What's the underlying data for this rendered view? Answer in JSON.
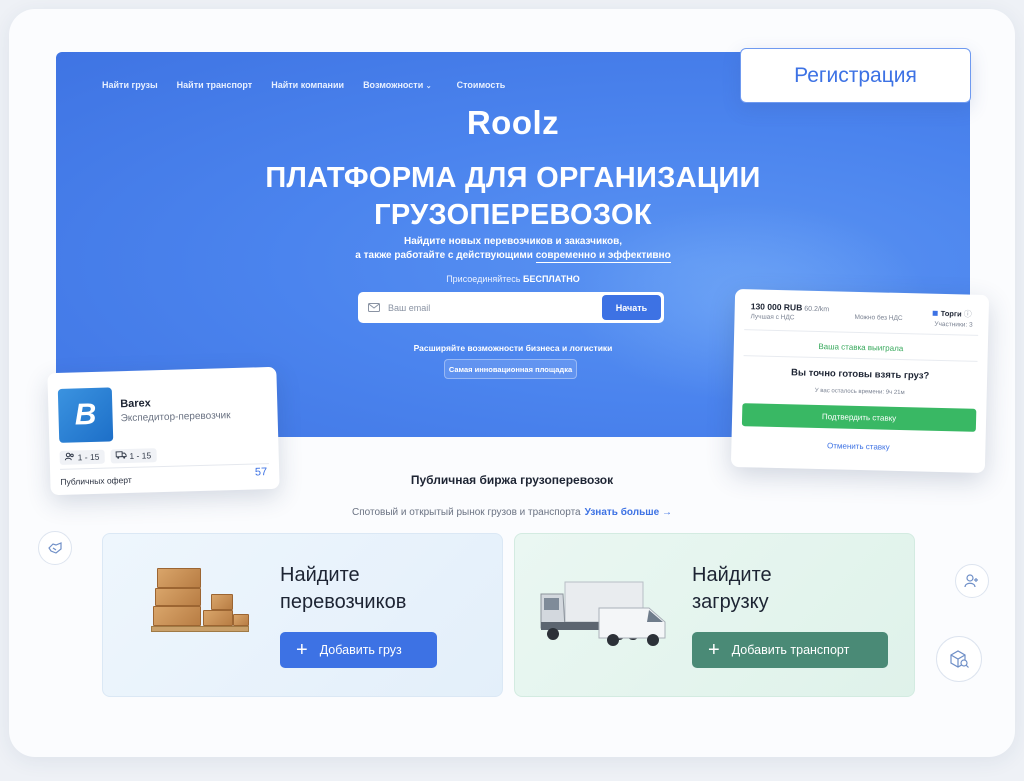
{
  "nav": {
    "items": [
      "Найти грузы",
      "Найти транспорт",
      "Найти компании",
      "Возможности",
      "Стоимость"
    ]
  },
  "register_label": "Регистрация",
  "hero": {
    "logo": "Roolz",
    "headline_line1": "ПЛАТФОРМА ДЛЯ ОРГАНИЗАЦИИ",
    "headline_line2": "ГРУЗОПЕРЕВОЗОК",
    "sub_line1": "Найдите новых перевозчиков и заказчиков,",
    "sub_line2_prefix": "а также работайте с действующими ",
    "sub_line2_emph": "современно и эффективно",
    "join_prefix": "Присоединяйтесь ",
    "join_bold": "БЕСПЛАТНО",
    "email_placeholder": "Ваш email",
    "start_label": "Начать",
    "expand_text": "Расширяйте возможности бизнеса и логистики",
    "pill_text": "Самая инновационная площадка"
  },
  "company_card": {
    "logo_letter": "B",
    "name": "Barex",
    "role": "Экспедитор-перевозчик",
    "tag1": "1 - 15",
    "tag2": "1 - 15",
    "offers_label": "Публичных оферт",
    "offers_count": "57"
  },
  "bid_card": {
    "price": "130 000 RUB",
    "rate": "60.2/km",
    "best": "Лучшая с НДС",
    "nds": "Можно без НДС",
    "torgi": "Торги",
    "participants": "Участники: 3",
    "won": "Ваша ставка выиграла",
    "question": "Вы точно готовы взять груз?",
    "time_left": "У вас осталось времени: 9ч 21м",
    "confirm": "Подтвердить ставку",
    "cancel": "Отменить ставку"
  },
  "exchange": {
    "title": "Публичная биржа грузоперевозок",
    "subtitle": "Спотовый и открытый рынок грузов и транспорта",
    "more": "Узнать больше →"
  },
  "cards": {
    "carriers_line1": "Найдите",
    "carriers_line2": "перевозчиков",
    "add_cargo": "Добавить груз",
    "cargo_line1": "Найдите",
    "cargo_line2": "загрузку",
    "add_transport": "Добавить транспорт"
  },
  "colors": {
    "accent": "#3d72e4",
    "green": "#39b864",
    "teal": "#4a8a76"
  }
}
